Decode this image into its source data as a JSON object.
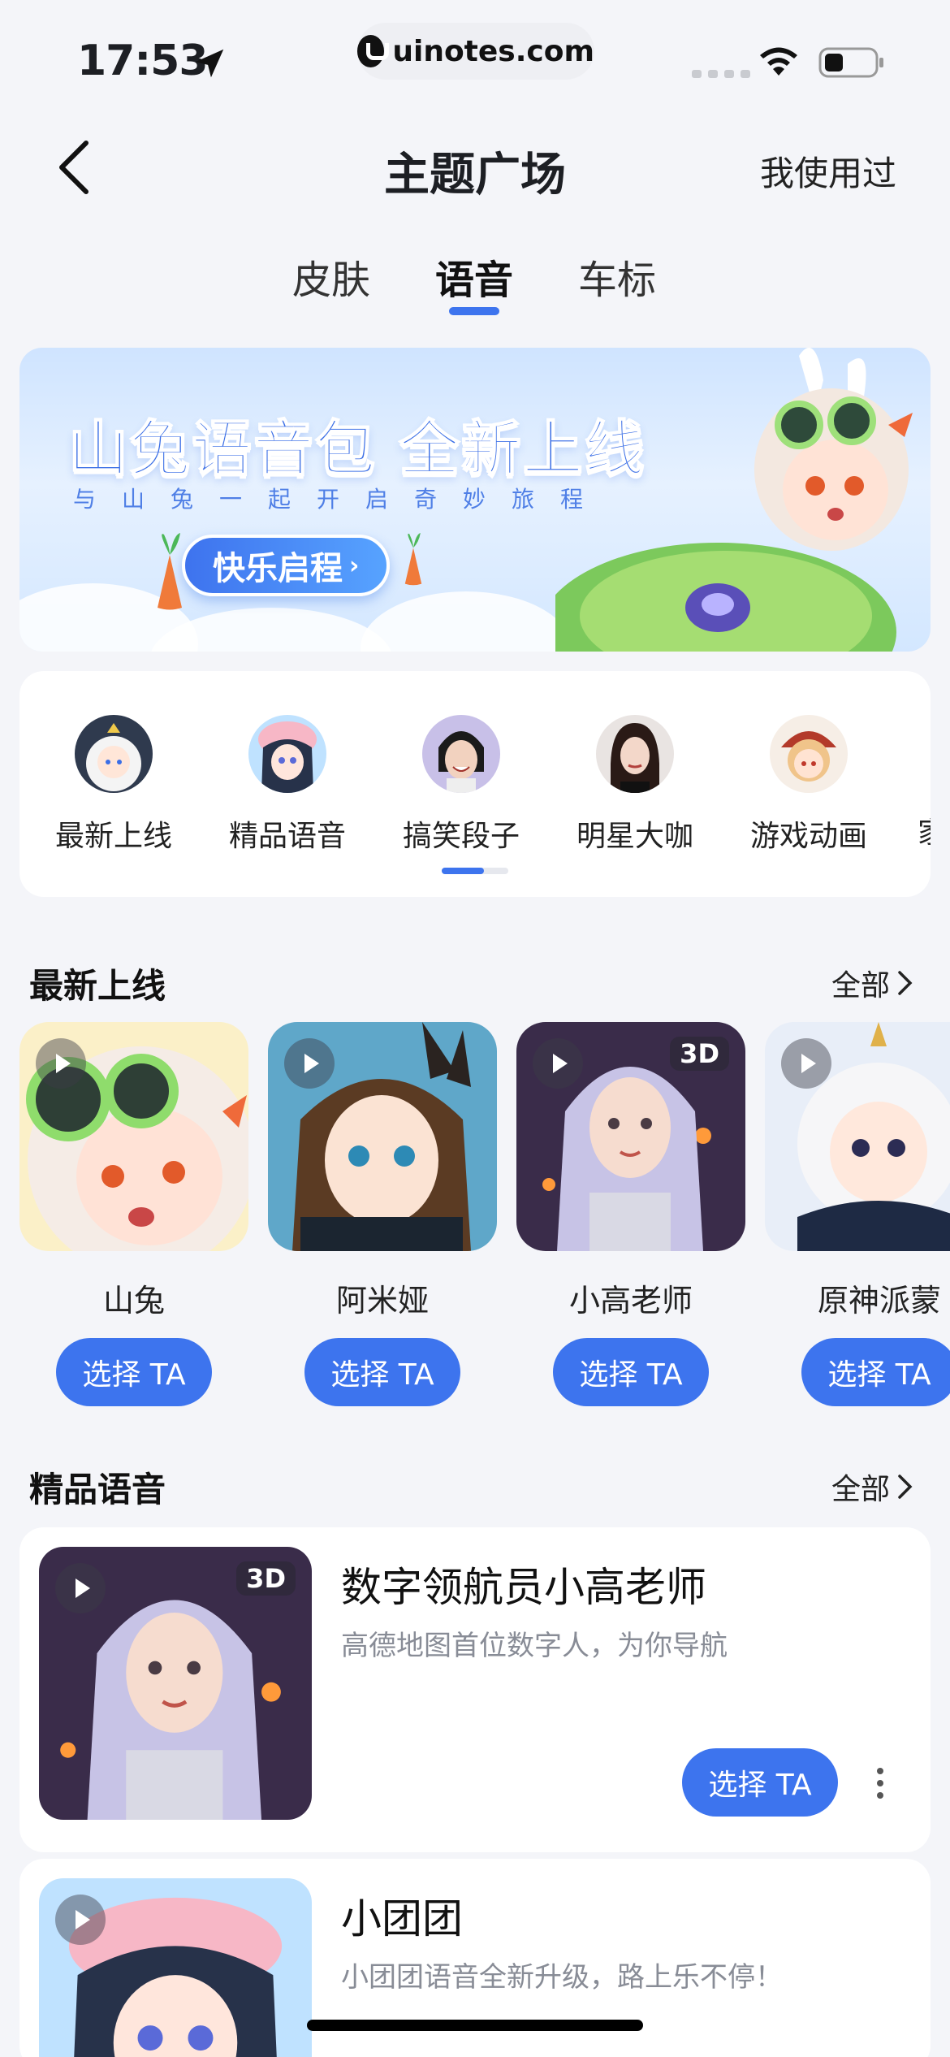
{
  "status_bar": {
    "time": "17:53",
    "url": "uinotes.com"
  },
  "header": {
    "title": "主题广场",
    "used_link": "我使用过"
  },
  "tabs": [
    {
      "label": "皮肤",
      "active": false
    },
    {
      "label": "语音",
      "active": true
    },
    {
      "label": "车标",
      "active": false
    }
  ],
  "banner": {
    "title": "山兔语音包 全新上线",
    "subtitle": "与山兔一起开启奇妙旅程",
    "button": "快乐启程"
  },
  "categories": [
    {
      "label": "最新上线",
      "icon": "anime-girl-icon"
    },
    {
      "label": "精品语音",
      "icon": "piggy-hat-girl-icon"
    },
    {
      "label": "搞笑段子",
      "icon": "smiling-woman-icon"
    },
    {
      "label": "明星大咖",
      "icon": "celebrity-woman-icon"
    },
    {
      "label": "游戏动画",
      "icon": "game-character-icon"
    },
    {
      "label": "家",
      "icon": "partial-item-icon"
    }
  ],
  "new_section": {
    "title": "最新上线",
    "more": "全部",
    "items": [
      {
        "name": "山兔",
        "button": "选择 TA",
        "badge": ""
      },
      {
        "name": "阿米娅",
        "button": "选择 TA",
        "badge": ""
      },
      {
        "name": "小高老师",
        "button": "选择 TA",
        "badge": "3D"
      },
      {
        "name": "原神派蒙",
        "button": "选择 TA",
        "badge": ""
      }
    ]
  },
  "premium_section": {
    "title": "精品语音",
    "more": "全部",
    "items": [
      {
        "title": "数字领航员小高老师",
        "desc": "高德地图首位数字人，为你导航",
        "button": "选择 TA",
        "badge": "3D"
      },
      {
        "title": "小团团",
        "desc": "小团团语音全新升级，路上乐不停！",
        "button": "选择 TA",
        "badge": ""
      }
    ]
  },
  "colors": {
    "accent": "#3d74ee",
    "background": "#f4f5f9"
  }
}
